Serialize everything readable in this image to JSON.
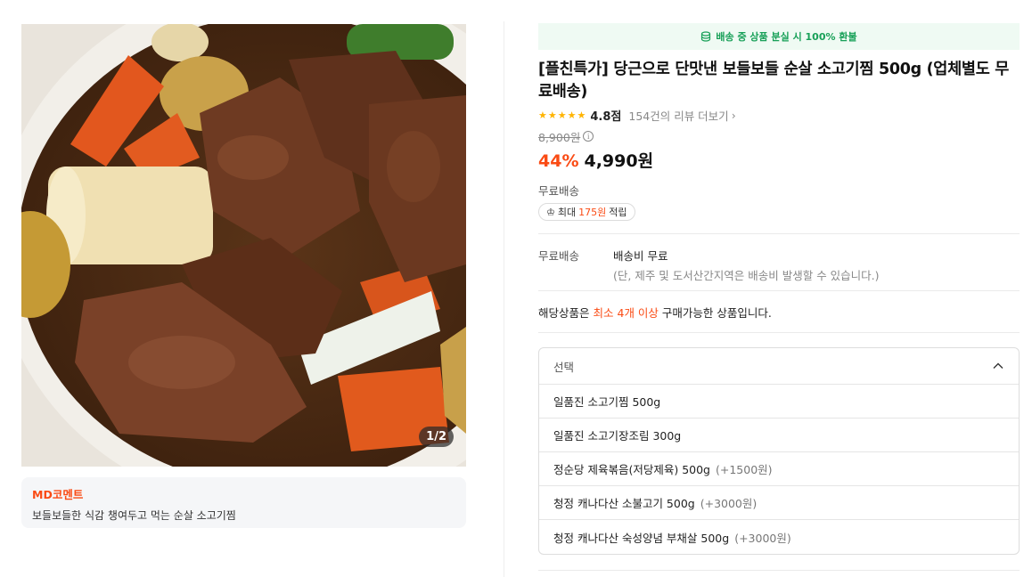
{
  "gallery": {
    "counter": "1/2"
  },
  "md_comment": {
    "title": "MD코멘트",
    "text": "보들보들한 식감 챙여두고 먹는 순살 소고기찜"
  },
  "refund_banner": {
    "text": "배송 중 상품 분실 시 100% 환불",
    "color": "#18a058"
  },
  "product": {
    "title": "[플친특가] 당근으로 단맛낸 보들보들 순살 소고기찜 500g (업체별도 무료배송)",
    "rating": "4.8점",
    "review_link": "154건의 리뷰 더보기",
    "original_price": "8,900원",
    "discount": "44%",
    "price": "4,990원",
    "accent_color": "#fa4b14"
  },
  "shipping": {
    "label": "무료배송",
    "point_prefix": "최대",
    "point_amount": "175원",
    "point_suffix": "적립",
    "detail_label": "무료배송",
    "detail_value": "배송비 무료",
    "detail_note": "(단, 제주 및 도서산간지역은 배송비 발생할 수 있습니다.)"
  },
  "min_purchase": {
    "prefix": "해당상품은",
    "highlight": "최소 4개 이상",
    "suffix": "구매가능한 상품입니다."
  },
  "options": {
    "label": "선택",
    "items": [
      {
        "name": "일품진 소고기찜 500g",
        "extra": ""
      },
      {
        "name": "일품진 소고기장조림 300g",
        "extra": ""
      },
      {
        "name": "정순당 제육볶음(저당제육) 500g",
        "extra": "(+1500원)"
      },
      {
        "name": "청정 캐나다산 소불고기 500g",
        "extra": "(+3000원)"
      },
      {
        "name": "청정 캐나다산 숙성양념 부채살 500g",
        "extra": "(+3000원)"
      }
    ]
  }
}
